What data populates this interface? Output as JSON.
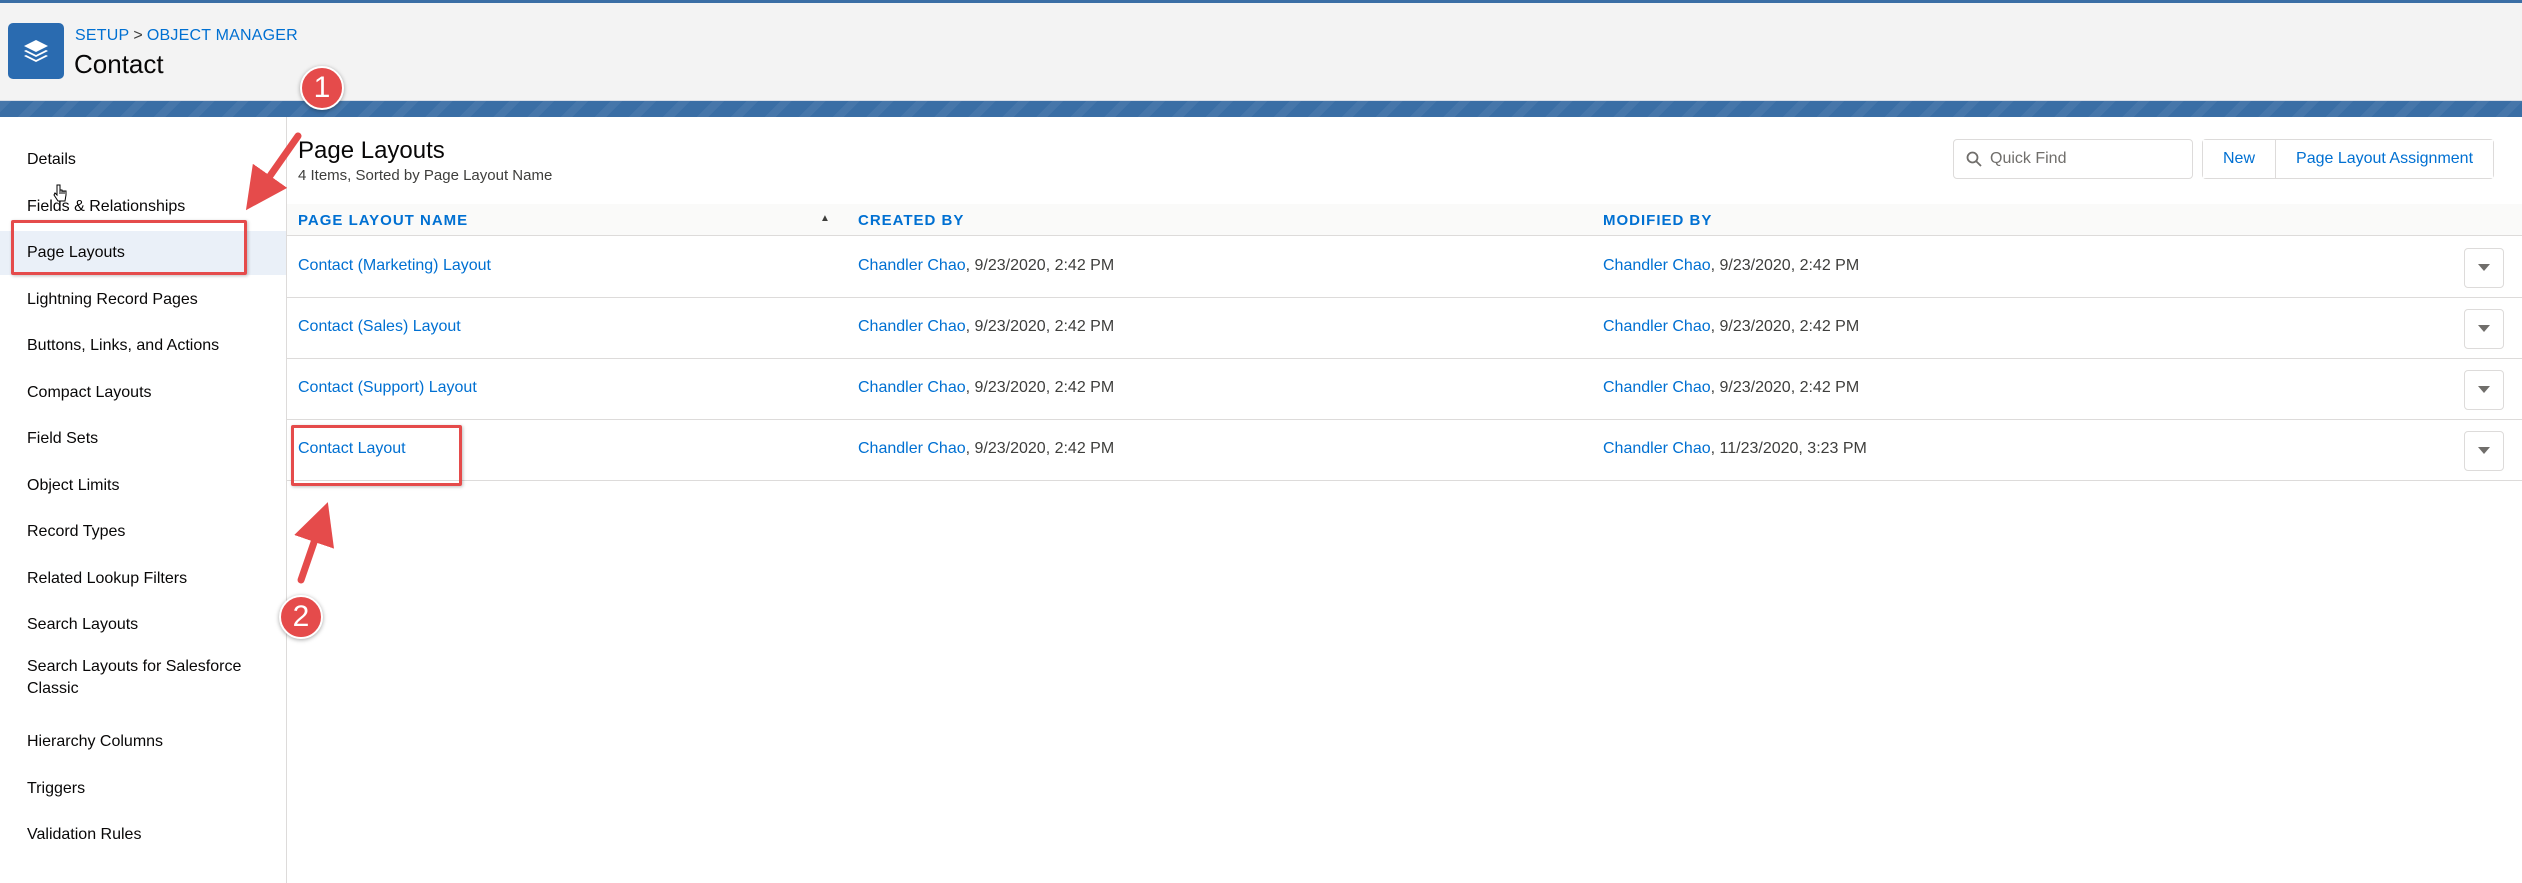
{
  "header": {
    "breadcrumb": [
      "SETUP",
      "OBJECT MANAGER"
    ],
    "breadcrumb_sep": ">",
    "title": "Contact",
    "icon": "layers-icon"
  },
  "sidebar": {
    "items": [
      {
        "label": "Details"
      },
      {
        "label": "Fields & Relationships"
      },
      {
        "label": "Page Layouts",
        "selected": true
      },
      {
        "label": "Lightning Record Pages"
      },
      {
        "label": "Buttons, Links, and Actions"
      },
      {
        "label": "Compact Layouts"
      },
      {
        "label": "Field Sets"
      },
      {
        "label": "Object Limits"
      },
      {
        "label": "Record Types"
      },
      {
        "label": "Related Lookup Filters"
      },
      {
        "label": "Search Layouts"
      },
      {
        "label": "Search Layouts for Salesforce Classic"
      },
      {
        "label": "Hierarchy Columns"
      },
      {
        "label": "Triggers"
      },
      {
        "label": "Validation Rules"
      }
    ]
  },
  "main": {
    "title": "Page Layouts",
    "subtitle": "4 Items, Sorted by Page Layout Name",
    "quick_find_placeholder": "Quick Find",
    "buttons": {
      "new": "New",
      "assignment": "Page Layout Assignment"
    },
    "columns": [
      "PAGE LAYOUT NAME",
      "CREATED BY",
      "MODIFIED BY"
    ],
    "rows": [
      {
        "name": "Contact (Marketing) Layout",
        "created_by": "Chandler Chao",
        "created_at": ", 9/23/2020, 2:42 PM",
        "modified_by": "Chandler Chao",
        "modified_at": ", 9/23/2020, 2:42 PM"
      },
      {
        "name": "Contact (Sales) Layout",
        "created_by": "Chandler Chao",
        "created_at": ", 9/23/2020, 2:42 PM",
        "modified_by": "Chandler Chao",
        "modified_at": ", 9/23/2020, 2:42 PM"
      },
      {
        "name": "Contact (Support) Layout",
        "created_by": "Chandler Chao",
        "created_at": ", 9/23/2020, 2:42 PM",
        "modified_by": "Chandler Chao",
        "modified_at": ", 9/23/2020, 2:42 PM"
      },
      {
        "name": "Contact Layout",
        "created_by": "Chandler Chao",
        "created_at": ", 9/23/2020, 2:42 PM",
        "modified_by": "Chandler Chao",
        "modified_at": ", 11/23/2020, 3:23 PM"
      }
    ]
  },
  "annotations": {
    "badge_1": "1",
    "badge_2": "2",
    "color": "#e54b4b"
  },
  "colors": {
    "brand_blue": "#2a6bb0",
    "link_blue": "#0070d2",
    "band_blue": "#3a6ea5",
    "selected_bg": "#eaf0f8"
  }
}
